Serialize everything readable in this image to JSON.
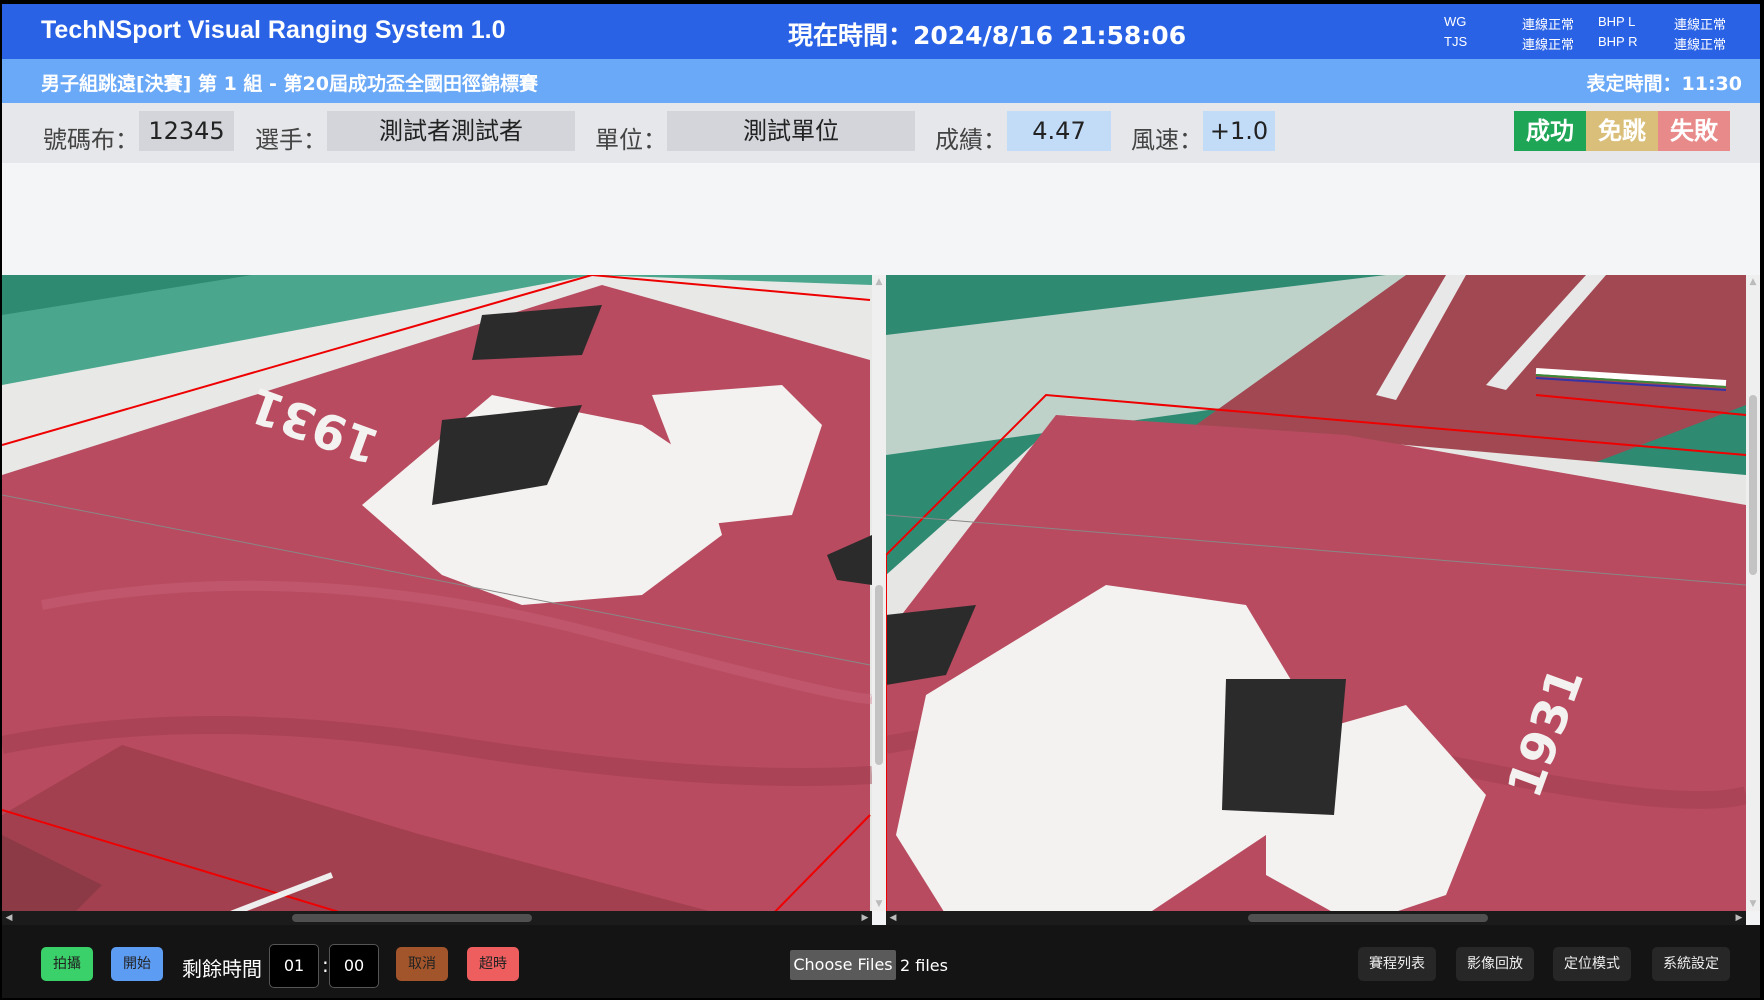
{
  "header": {
    "title": "TechNSport Visual Ranging System 1.0",
    "clock": "現在時間：2024/8/16 21:58:06",
    "status": [
      {
        "name": "WG",
        "state": "連線正常"
      },
      {
        "name": "TJS",
        "state": "連線正常"
      },
      {
        "name": "BHP L",
        "state": "連線正常"
      },
      {
        "name": "BHP R",
        "state": "連線正常"
      }
    ]
  },
  "event": {
    "name": "男子組跳遠[決賽] 第 1 組 - 第20屆成功盃全國田徑錦標賽",
    "scheduled_time": "表定時間：11:30"
  },
  "athlete": {
    "bib_label": "號碼布：",
    "bib": "12345",
    "name_label": "選手：",
    "name": "測試者測試者",
    "unit_label": "單位：",
    "unit": "測試單位",
    "result_label": "成績：",
    "result": "4.47",
    "wind_label": "風速：",
    "wind": "+1.0"
  },
  "judgement": {
    "success": "成功",
    "skip": "免跳",
    "fail": "失敗",
    "colors": {
      "success": "#1ea556",
      "skip": "#d9bf7a",
      "fail": "#e98a8a"
    }
  },
  "images": {
    "left_label_text": "1931",
    "right_label_text": "1931"
  },
  "footer": {
    "capture": "拍攝",
    "start": "開始",
    "remaining_label": "剩餘時間",
    "minutes": "01",
    "separator": ":",
    "seconds": "00",
    "cancel": "取消",
    "overtime": "超時",
    "choose_files": "Choose Files",
    "files_status": "2 files",
    "schedule": "賽程列表",
    "playback": "影像回放",
    "locate": "定位模式",
    "settings": "系統設定"
  }
}
